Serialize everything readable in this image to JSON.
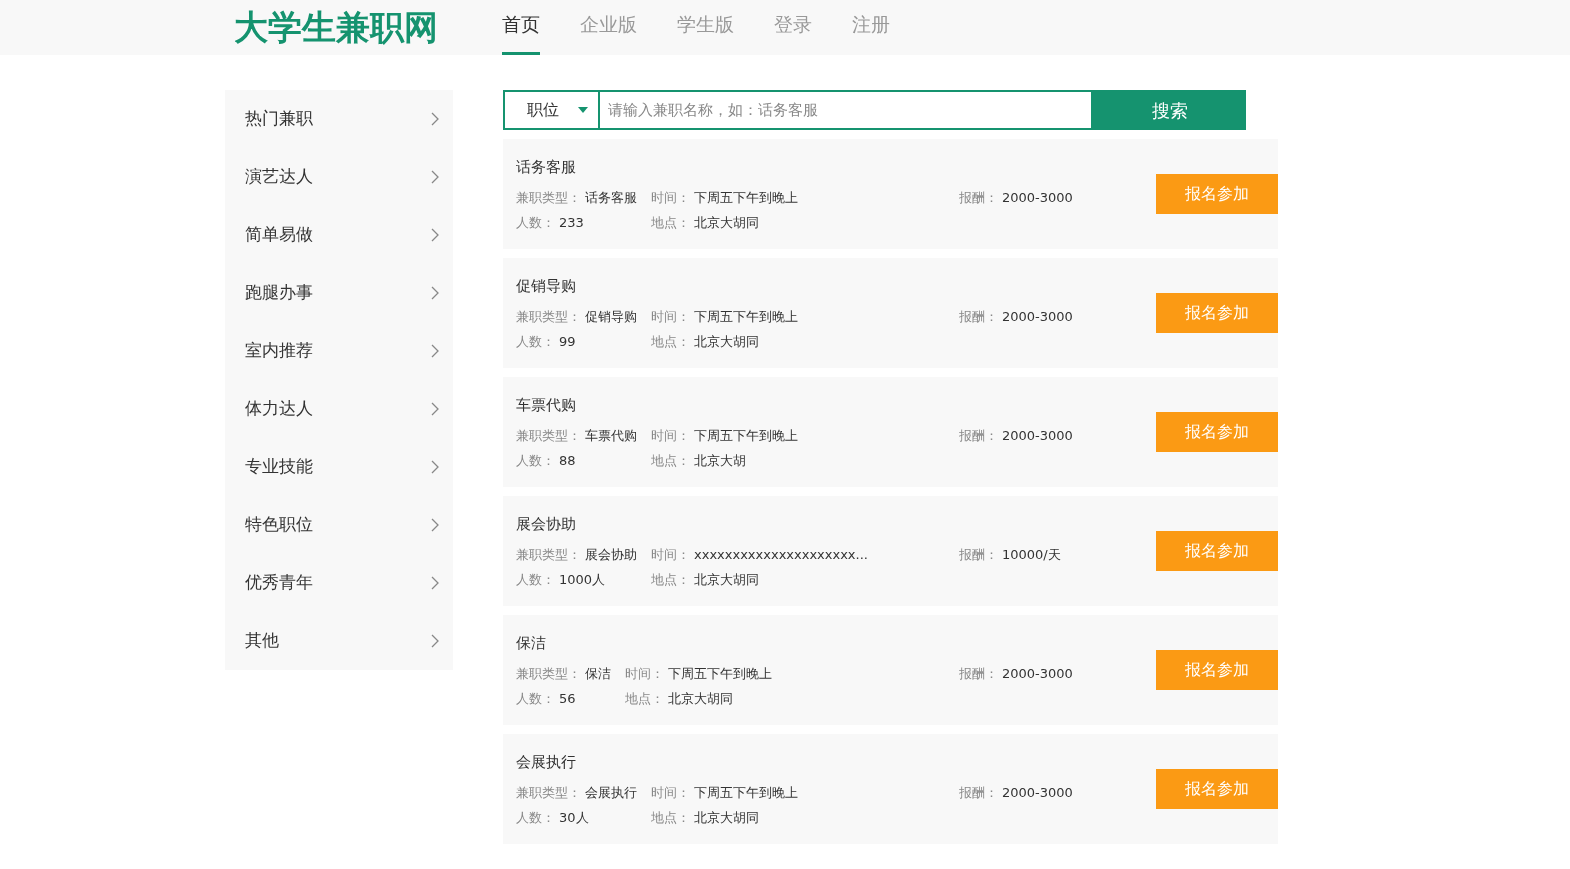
{
  "logo": "大学生兼职网",
  "nav": [
    {
      "label": "首页",
      "selected": true
    },
    {
      "label": "企业版",
      "selected": false
    },
    {
      "label": "学生版",
      "selected": false
    },
    {
      "label": "登录",
      "selected": false
    },
    {
      "label": "注册",
      "selected": false
    }
  ],
  "sidebar": {
    "items": [
      "热门兼职",
      "演艺达人",
      "简单易做",
      "跑腿办事",
      "室内推荐",
      "体力达人",
      "专业技能",
      "特色职位",
      "优秀青年",
      "其他"
    ]
  },
  "search": {
    "category": "职位",
    "placeholder": "请输入兼职名称，如：话务客服",
    "button": "搜索"
  },
  "jobs": [
    {
      "title": "话务客服",
      "fields": [
        {
          "label": "兼职类型：",
          "value": "话务客服"
        },
        {
          "label": "时间：",
          "value": "下周五下午到晚上"
        },
        {
          "label": "报酬：",
          "value": "2000-3000"
        },
        {
          "label": "人数：",
          "value": "233"
        },
        {
          "label": "地点：",
          "value": "北京大胡同"
        }
      ],
      "button": "报名参加"
    },
    {
      "title": "促销导购",
      "fields": [
        {
          "label": "兼职类型：",
          "value": "促销导购"
        },
        {
          "label": "时间：",
          "value": "下周五下午到晚上"
        },
        {
          "label": "报酬：",
          "value": "2000-3000"
        },
        {
          "label": "人数：",
          "value": "99"
        },
        {
          "label": "地点：",
          "value": "北京大胡同"
        }
      ],
      "button": "报名参加"
    },
    {
      "title": "车票代购",
      "fields": [
        {
          "label": "兼职类型：",
          "value": "车票代购"
        },
        {
          "label": "时间：",
          "value": "下周五下午到晚上"
        },
        {
          "label": "报酬：",
          "value": "2000-3000"
        },
        {
          "label": "人数：",
          "value": "88"
        },
        {
          "label": "地点：",
          "value": "北京大胡"
        }
      ],
      "button": "报名参加"
    },
    {
      "title": "展会协助",
      "fields": [
        {
          "label": "兼职类型：",
          "value": "展会协助"
        },
        {
          "label": "时间：",
          "value": "xxxxxxxxxxxxxxxxxxxxx..."
        },
        {
          "label": "报酬：",
          "value": "10000/天"
        },
        {
          "label": "人数：",
          "value": "1000人"
        },
        {
          "label": "地点：",
          "value": "北京大胡同"
        }
      ],
      "button": "报名参加"
    },
    {
      "title": "保洁",
      "fields": [
        {
          "label": "兼职类型：",
          "value": "保洁"
        },
        {
          "label": "时间：",
          "value": "下周五下午到晚上"
        },
        {
          "label": "报酬：",
          "value": "2000-3000"
        },
        {
          "label": "人数：",
          "value": "56"
        },
        {
          "label": "地点：",
          "value": "北京大胡同"
        }
      ],
      "button": "报名参加"
    },
    {
      "title": "会展执行",
      "fields": [
        {
          "label": "兼职类型：",
          "value": "会展执行"
        },
        {
          "label": "时间：",
          "value": "下周五下午到晚上"
        },
        {
          "label": "报酬：",
          "value": "2000-3000"
        },
        {
          "label": "人数：",
          "value": "30人"
        },
        {
          "label": "地点：",
          "value": "北京大胡同"
        }
      ],
      "button": "报名参加"
    }
  ]
}
